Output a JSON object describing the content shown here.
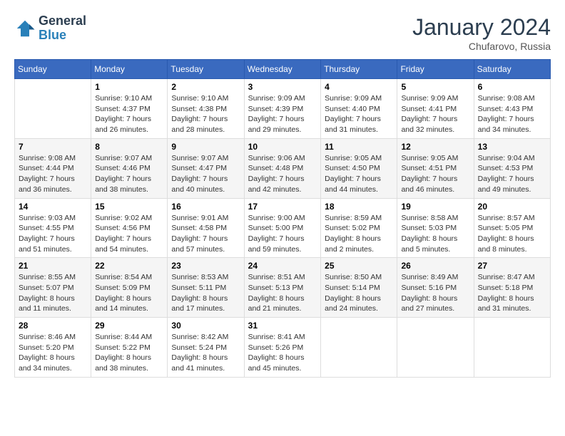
{
  "logo": {
    "line1": "General",
    "line2": "Blue"
  },
  "title": "January 2024",
  "location": "Chufarovo, Russia",
  "days_of_week": [
    "Sunday",
    "Monday",
    "Tuesday",
    "Wednesday",
    "Thursday",
    "Friday",
    "Saturday"
  ],
  "weeks": [
    [
      {
        "day": "",
        "info": ""
      },
      {
        "day": "1",
        "info": "Sunrise: 9:10 AM\nSunset: 4:37 PM\nDaylight: 7 hours\nand 26 minutes."
      },
      {
        "day": "2",
        "info": "Sunrise: 9:10 AM\nSunset: 4:38 PM\nDaylight: 7 hours\nand 28 minutes."
      },
      {
        "day": "3",
        "info": "Sunrise: 9:09 AM\nSunset: 4:39 PM\nDaylight: 7 hours\nand 29 minutes."
      },
      {
        "day": "4",
        "info": "Sunrise: 9:09 AM\nSunset: 4:40 PM\nDaylight: 7 hours\nand 31 minutes."
      },
      {
        "day": "5",
        "info": "Sunrise: 9:09 AM\nSunset: 4:41 PM\nDaylight: 7 hours\nand 32 minutes."
      },
      {
        "day": "6",
        "info": "Sunrise: 9:08 AM\nSunset: 4:43 PM\nDaylight: 7 hours\nand 34 minutes."
      }
    ],
    [
      {
        "day": "7",
        "info": "Sunrise: 9:08 AM\nSunset: 4:44 PM\nDaylight: 7 hours\nand 36 minutes."
      },
      {
        "day": "8",
        "info": "Sunrise: 9:07 AM\nSunset: 4:46 PM\nDaylight: 7 hours\nand 38 minutes."
      },
      {
        "day": "9",
        "info": "Sunrise: 9:07 AM\nSunset: 4:47 PM\nDaylight: 7 hours\nand 40 minutes."
      },
      {
        "day": "10",
        "info": "Sunrise: 9:06 AM\nSunset: 4:48 PM\nDaylight: 7 hours\nand 42 minutes."
      },
      {
        "day": "11",
        "info": "Sunrise: 9:05 AM\nSunset: 4:50 PM\nDaylight: 7 hours\nand 44 minutes."
      },
      {
        "day": "12",
        "info": "Sunrise: 9:05 AM\nSunset: 4:51 PM\nDaylight: 7 hours\nand 46 minutes."
      },
      {
        "day": "13",
        "info": "Sunrise: 9:04 AM\nSunset: 4:53 PM\nDaylight: 7 hours\nand 49 minutes."
      }
    ],
    [
      {
        "day": "14",
        "info": "Sunrise: 9:03 AM\nSunset: 4:55 PM\nDaylight: 7 hours\nand 51 minutes."
      },
      {
        "day": "15",
        "info": "Sunrise: 9:02 AM\nSunset: 4:56 PM\nDaylight: 7 hours\nand 54 minutes."
      },
      {
        "day": "16",
        "info": "Sunrise: 9:01 AM\nSunset: 4:58 PM\nDaylight: 7 hours\nand 57 minutes."
      },
      {
        "day": "17",
        "info": "Sunrise: 9:00 AM\nSunset: 5:00 PM\nDaylight: 7 hours\nand 59 minutes."
      },
      {
        "day": "18",
        "info": "Sunrise: 8:59 AM\nSunset: 5:02 PM\nDaylight: 8 hours\nand 2 minutes."
      },
      {
        "day": "19",
        "info": "Sunrise: 8:58 AM\nSunset: 5:03 PM\nDaylight: 8 hours\nand 5 minutes."
      },
      {
        "day": "20",
        "info": "Sunrise: 8:57 AM\nSunset: 5:05 PM\nDaylight: 8 hours\nand 8 minutes."
      }
    ],
    [
      {
        "day": "21",
        "info": "Sunrise: 8:55 AM\nSunset: 5:07 PM\nDaylight: 8 hours\nand 11 minutes."
      },
      {
        "day": "22",
        "info": "Sunrise: 8:54 AM\nSunset: 5:09 PM\nDaylight: 8 hours\nand 14 minutes."
      },
      {
        "day": "23",
        "info": "Sunrise: 8:53 AM\nSunset: 5:11 PM\nDaylight: 8 hours\nand 17 minutes."
      },
      {
        "day": "24",
        "info": "Sunrise: 8:51 AM\nSunset: 5:13 PM\nDaylight: 8 hours\nand 21 minutes."
      },
      {
        "day": "25",
        "info": "Sunrise: 8:50 AM\nSunset: 5:14 PM\nDaylight: 8 hours\nand 24 minutes."
      },
      {
        "day": "26",
        "info": "Sunrise: 8:49 AM\nSunset: 5:16 PM\nDaylight: 8 hours\nand 27 minutes."
      },
      {
        "day": "27",
        "info": "Sunrise: 8:47 AM\nSunset: 5:18 PM\nDaylight: 8 hours\nand 31 minutes."
      }
    ],
    [
      {
        "day": "28",
        "info": "Sunrise: 8:46 AM\nSunset: 5:20 PM\nDaylight: 8 hours\nand 34 minutes."
      },
      {
        "day": "29",
        "info": "Sunrise: 8:44 AM\nSunset: 5:22 PM\nDaylight: 8 hours\nand 38 minutes."
      },
      {
        "day": "30",
        "info": "Sunrise: 8:42 AM\nSunset: 5:24 PM\nDaylight: 8 hours\nand 41 minutes."
      },
      {
        "day": "31",
        "info": "Sunrise: 8:41 AM\nSunset: 5:26 PM\nDaylight: 8 hours\nand 45 minutes."
      },
      {
        "day": "",
        "info": ""
      },
      {
        "day": "",
        "info": ""
      },
      {
        "day": "",
        "info": ""
      }
    ]
  ]
}
